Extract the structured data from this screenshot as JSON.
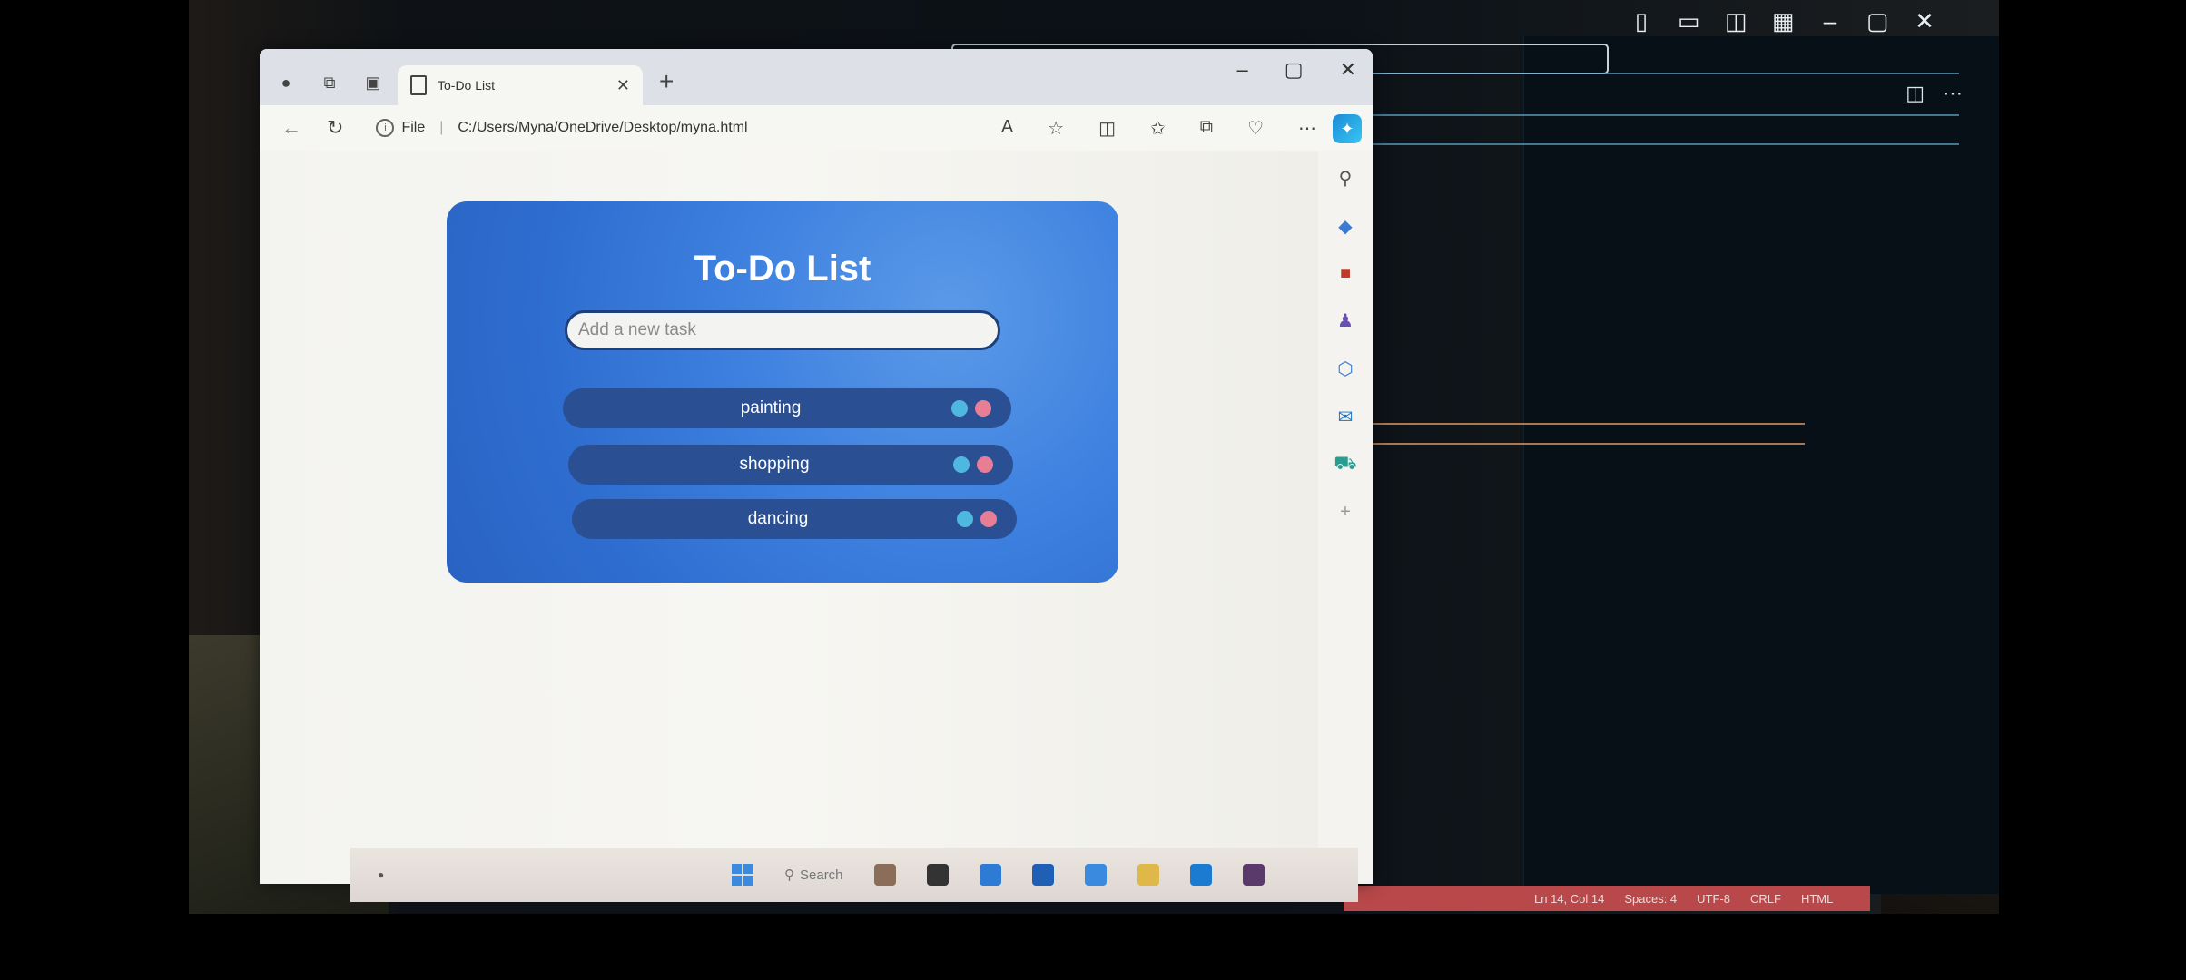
{
  "browser": {
    "tab_title": "To-Do List",
    "address_prefix": "File",
    "url": "C:/Users/Myna/OneDrive/Desktop/myna.html"
  },
  "app": {
    "title": "To-Do List",
    "input_placeholder": "Add a new task",
    "tasks": [
      {
        "label": "painting"
      },
      {
        "label": "shopping"
      },
      {
        "label": "dancing"
      }
    ]
  },
  "colors": {
    "app_bg": "#3f82e0",
    "task_bg": "#2a4f93",
    "done_button": "#4fb8e0",
    "delete_button": "#e87e96"
  },
  "taskbar": {
    "search_label": "Search"
  },
  "editor": {
    "status": [
      "Ln 14, Col 14",
      "Spaces: 4",
      "UTF-8",
      "CRLF",
      "HTML"
    ]
  }
}
